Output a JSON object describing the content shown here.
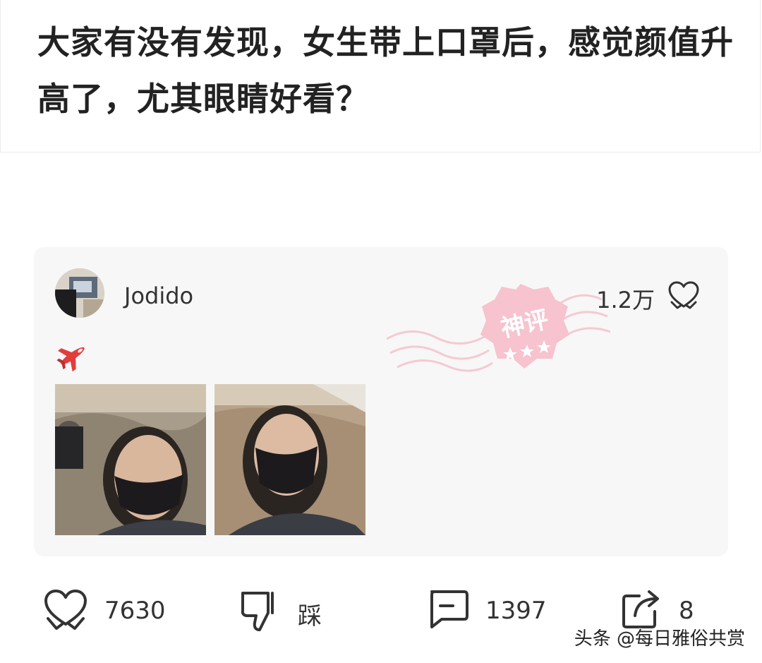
{
  "post": {
    "title": "大家有没有发现，女生带上口罩后，感觉颜值升高了，尤其眼睛好看？"
  },
  "comment": {
    "username": "Jodido",
    "like_count": "1.2万",
    "badge_text": "神评",
    "badge_color": "#f2a0b0",
    "emoji": "airplane-emoji"
  },
  "actions": {
    "like_count": "7630",
    "dislike_label": "踩",
    "comment_count": "1397",
    "share_count": "8"
  },
  "watermark": "头条 @每日雅俗共赏"
}
